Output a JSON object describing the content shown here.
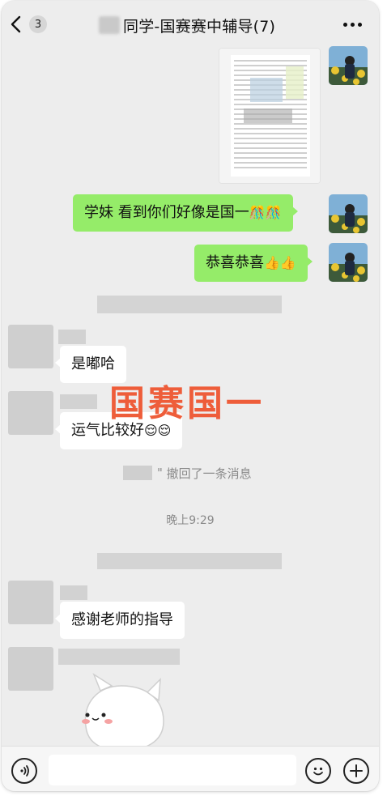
{
  "header": {
    "back_label": "‹",
    "unread_count": "3",
    "title": "同学-国赛赛中辅导(7)",
    "more_icon": "ellipsis-icon"
  },
  "messages": {
    "image_caption": "图片消息",
    "msg1": {
      "text": "学妹 看到你们好像是国一",
      "emoji": "🎊🎊"
    },
    "msg2": {
      "text": "恭喜恭喜",
      "emoji": "👍👍"
    },
    "msg3": {
      "text": "是嘟哈"
    },
    "msg4": {
      "text": "运气比较好",
      "emoji": "😌😌"
    },
    "recall_text": "撤回了一条消息",
    "timestamp": "晚上9:29",
    "msg5": {
      "text": "感谢老师的指导"
    }
  },
  "overlay": {
    "text": "国赛国一"
  },
  "input": {
    "placeholder": ""
  },
  "colors": {
    "background": "#ededed",
    "bubble_self": "#95ec69",
    "bubble_other": "#ffffff",
    "overlay_text": "#ee5d3a"
  }
}
